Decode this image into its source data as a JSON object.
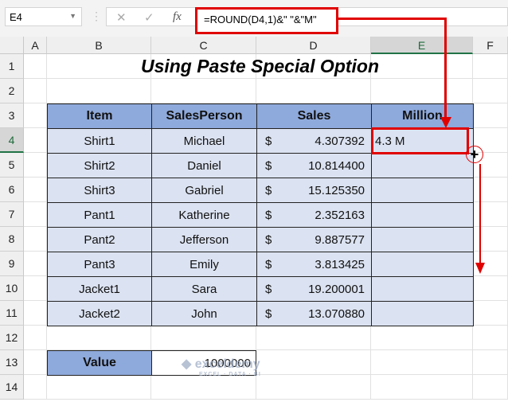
{
  "name_box": "E4",
  "formula_bar": {
    "cancel": "✕",
    "enter": "✓",
    "fx": "fx",
    "formula": "=ROUND(D4,1)&\" \"&\"M\""
  },
  "columns": [
    "A",
    "B",
    "C",
    "D",
    "E",
    "F"
  ],
  "rows": [
    "1",
    "2",
    "3",
    "4",
    "5",
    "6",
    "7",
    "8",
    "9",
    "10",
    "11",
    "12",
    "13",
    "14"
  ],
  "title": "Using Paste Special Option",
  "table": {
    "headers": [
      "Item",
      "SalesPerson",
      "Sales",
      "Million"
    ],
    "currency": "$",
    "data": [
      [
        "Shirt1",
        "Michael",
        "4.307392",
        "4.3 M"
      ],
      [
        "Shirt2",
        "Daniel",
        "10.814400",
        ""
      ],
      [
        "Shirt3",
        "Gabriel",
        "15.125350",
        ""
      ],
      [
        "Pant1",
        "Katherine",
        "2.352163",
        ""
      ],
      [
        "Pant2",
        "Jefferson",
        "9.887577",
        ""
      ],
      [
        "Pant3",
        "Emily",
        "3.813425",
        ""
      ],
      [
        "Jacket1",
        "Sara",
        "19.200001",
        ""
      ],
      [
        "Jacket2",
        "John",
        "13.070880",
        ""
      ]
    ]
  },
  "value": {
    "label": "Value",
    "amount": "1000000"
  },
  "watermark": {
    "name": "exceldemy",
    "tagline": "EXCEL · DATA · BI"
  },
  "colors": {
    "header": "#8ea9db",
    "cell": "#dbe2f1",
    "annotation": "#e00000"
  }
}
